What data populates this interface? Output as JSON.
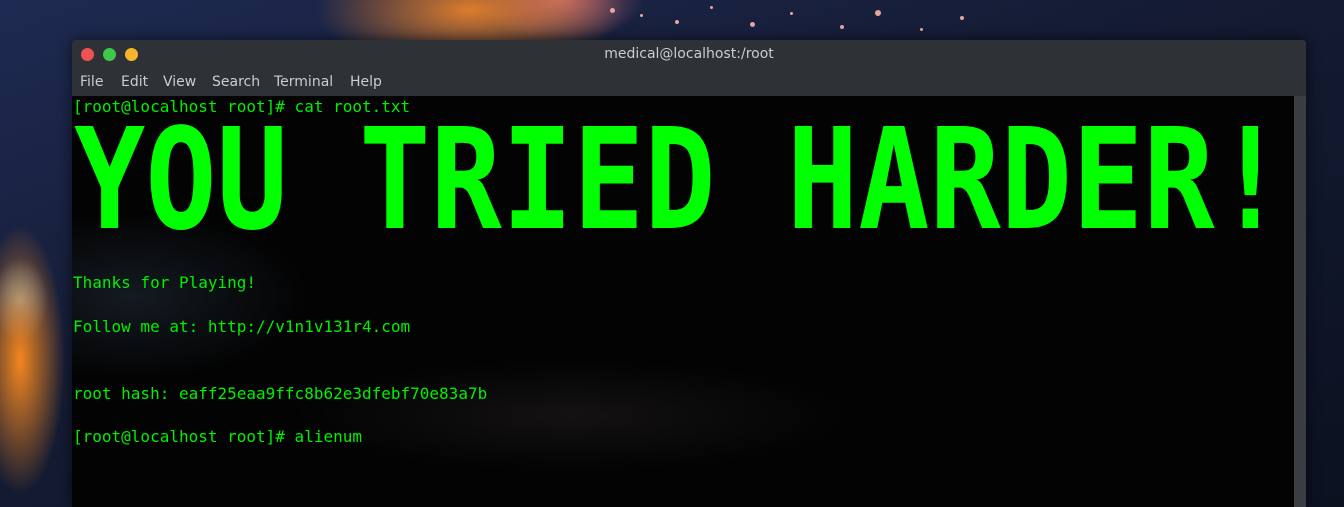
{
  "window": {
    "title": "medical@localhost:/root"
  },
  "menu": {
    "items": [
      "File",
      "Edit",
      "View",
      "Search",
      "Terminal",
      "Help"
    ]
  },
  "terminal": {
    "prompt_cmd": "[root@localhost root]# cat root.txt",
    "banner_text": "YOU TRIED HARDER!",
    "thanks": "Thanks for Playing!",
    "follow": "Follow me at: http://v1n1v131r4.com",
    "hash": "root hash: eaff25eaa9ffc8b62e3dfebf70e83a7b",
    "prompt_last": "[root@localhost root]# alienum"
  },
  "colors": {
    "terminal_text": "#00f000",
    "banner": "#00ff00",
    "close": "#f05252",
    "maximize": "#3fc94a",
    "minimize": "#f5b62a"
  }
}
